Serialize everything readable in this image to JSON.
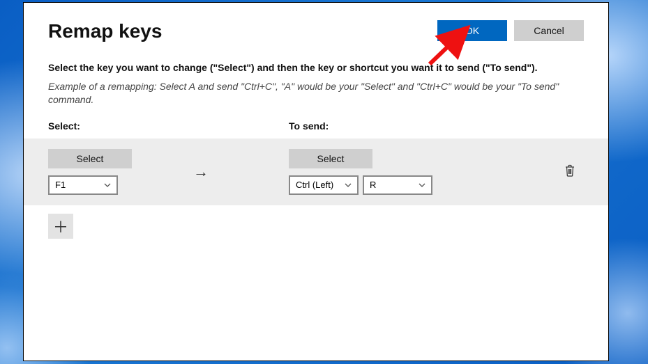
{
  "header": {
    "title": "Remap keys",
    "ok_label": "OK",
    "cancel_label": "Cancel"
  },
  "instructions": "Select the key you want to change (\"Select\") and then the key or shortcut you want it to send (\"To send\").",
  "example": "Example of a remapping: Select A and send \"Ctrl+C\", \"A\" would be your \"Select\" and \"Ctrl+C\" would be your \"To send\" command.",
  "columns": {
    "select": "Select:",
    "to_send": "To send:"
  },
  "mapping": {
    "select_button": "Select",
    "source_key": "F1",
    "dest_key1": "Ctrl (Left)",
    "dest_key2": "R"
  },
  "icons": {
    "arrow": "→",
    "add": "＋"
  }
}
